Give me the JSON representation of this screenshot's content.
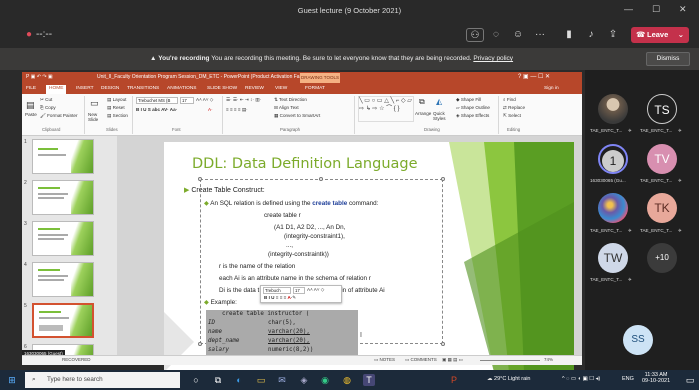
{
  "teams": {
    "window_title": "Guest lecture (9 October 2021)",
    "leave_label": "Leave",
    "recording_bold": "You're recording",
    "recording_text": "You are recording this meeting. Be sure to let everyone know that they are being recorded.",
    "privacy_link": "Privacy policy",
    "dismiss_label": "Dismiss",
    "accent_color": "#c4314b"
  },
  "ppt": {
    "title_text": "Unit_II_Faculty Orientation Program Session_DM_ETC  -  PowerPoint (Product Activation Fail...",
    "contextual_tab": "DRAWING TOOLS",
    "sign_in": "Sign in",
    "tabs": [
      "FILE",
      "HOME",
      "INSERT",
      "DESIGN",
      "TRANSITIONS",
      "ANIMATIONS",
      "SLIDE SHOW",
      "REVIEW",
      "VIEW",
      "FORMAT"
    ],
    "ribbon": {
      "paste": "Paste",
      "cut": "Cut",
      "copy": "Copy",
      "format_painter": "Format Painter",
      "clipboard": "Clipboard",
      "new_slide": "New Slide",
      "layout": "Layout",
      "reset": "Reset",
      "section": "Section",
      "slides": "Slides",
      "font_name": "Trebuchet MS (B",
      "font_size": "17",
      "font_group": "Font",
      "text_direction": "Text Direction",
      "align_text": "Align Text",
      "convert_smartart": "Convert to SmartArt",
      "paragraph": "Paragraph",
      "drawing": "Drawing",
      "arrange": "Arrange",
      "quick_styles": "Quick Styles",
      "shape_fill": "Shape Fill",
      "shape_outline": "Shape Outline",
      "shape_effects": "Shape Effects",
      "find": "Find",
      "replace": "Replace",
      "select": "Select",
      "editing": "Editing"
    },
    "thumb_numbers": [
      "1",
      "2",
      "3",
      "4",
      "5",
      "6"
    ],
    "selected_thumb": 5,
    "slide": {
      "title": "DDL: Data Definition Language",
      "bullet1": "Create Table Construct:",
      "sub1_pre": "An SQL relation is defined using the",
      "sub1_kw": "create table",
      "sub1_post": "command:",
      "line_create": "create table r",
      "line_attrs": "(A1 D1, A2 D2, ..., An Dn,",
      "line_ic1": "(integrity-constraint1),",
      "line_dots": "...,",
      "line_ick": "(integrity-constraintk))",
      "line_r": "r is the name of the relation",
      "line_each": "each Ai is an attribute name in the schema of relation r",
      "line_di_a": "Di is the data t",
      "line_di_b": "in of attribute Ai",
      "example": "Example:",
      "code": [
        [
          "create table",
          "instructor ("
        ],
        [
          "ID",
          "char(5),"
        ],
        [
          "name",
          "varchar(20),"
        ],
        [
          "dept_name",
          "varchar(20),"
        ],
        [
          "salary",
          "numeric(8,2))"
        ]
      ],
      "mini_font": "Trebuch",
      "mini_size": "17"
    },
    "status": {
      "notes": "NOTES",
      "comments": "COMMENTS",
      "zoom": "74%",
      "recovered": "RECOVERED"
    }
  },
  "participants": [
    {
      "initials": "",
      "label": "TAE_ENTC_T...",
      "color": "#8a7a6a",
      "photo": true
    },
    {
      "initials": "TS",
      "label": "TAE_ENTC_T...",
      "color": "#5b6378"
    },
    {
      "initials": "1",
      "label": "163030065 (Gu...",
      "color": "#5b6378",
      "ring": true
    },
    {
      "initials": "TV",
      "label": "TAE_ENTC_T...",
      "color": "#b05a7a"
    },
    {
      "initials": "",
      "label": "TAE_ENTC_T...",
      "color": "#6a5aa8",
      "photo": true
    },
    {
      "initials": "TK",
      "label": "TAE_ENTC_T...",
      "color": "#c25a5a"
    },
    {
      "initials": "TW",
      "label": "TAE_ENTC_T...",
      "color": "#4a7bb0"
    },
    {
      "initials": "+10",
      "label": "",
      "color": "#3b3b3b"
    },
    {
      "initials": "SS",
      "label": "",
      "color": "#2d6fa3"
    }
  ],
  "caller_tag": "163030065 (Guest)",
  "taskbar": {
    "search_placeholder": "Type here to search",
    "weather": "29°C  Light rain",
    "lang": "ENG",
    "time": "11:33 AM",
    "date": "09-10-2021"
  }
}
